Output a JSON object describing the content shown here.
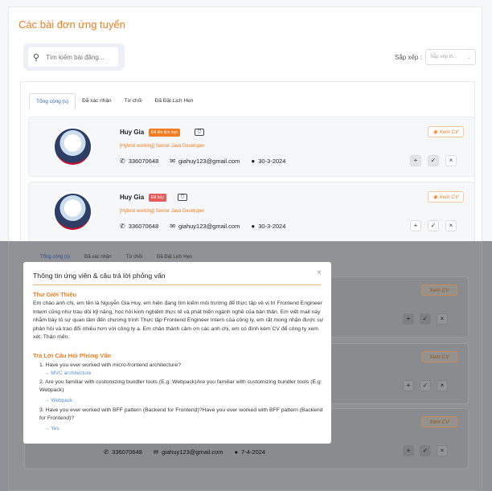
{
  "page": {
    "title": "Các bài đơn ứng tuyển"
  },
  "search": {
    "placeholder": "Tìm kiếm bài đăng..."
  },
  "sort": {
    "label": "Sắp xếp :",
    "placeholder": "Sắp xếp th..."
  },
  "tabs": [
    "Tổng cộng (s)",
    "Đã xác nhận",
    "Từ chối",
    "Đã Đặt Lịch Hẹn"
  ],
  "cards": [
    {
      "name": "Huy Gia",
      "badge": "Đã lên lịch hẹn",
      "job": "[Hybrid working] Senior Java Developer",
      "phone": "336070648",
      "email": "giahuy123@gmail.com",
      "date": "30-3-2024",
      "view": "Xem CV"
    },
    {
      "name": "Huy Gia",
      "badge": "Đã hủy",
      "job": "[Hybrid working] Senior Java Developer",
      "phone": "336070648",
      "email": "giahuy123@gmail.com",
      "date": "30-3-2024",
      "view": "Xem CV"
    }
  ],
  "background": {
    "tabs": [
      "Tổng cộng (s)",
      "Đã xác nhận",
      "Từ chối",
      "Đã Đặt Lịch Hẹn"
    ],
    "view": "Xem CV",
    "last_card": {
      "phone": "336070648",
      "email": "giahuy123@gmail.com",
      "date": "7-4-2024"
    }
  },
  "modal": {
    "title": "Thông tin ứng viên & câu trả lời phỏng vấn",
    "intro_heading": "Thư Giới Thiệu",
    "intro_text": "Em chào anh chị, em tên là Nguyễn Gia Huy, em hiện đang tìm kiếm môi trường để thực tập về vị trí Frontend Engineer Intern cũng như trau dồi kỹ năng, học hỏi kinh nghiệm thực tế và phát triển ngành nghề của bản thân. Em viết mail này nhằm bày tỏ sự quan tâm đến chương trình Thực tập Frontend Engineer Intern của công ty, em rất mong nhận được sự phản hồi và trao đổi nhiều hơn với công ty ạ. Em chân thành cảm ơn các anh chị, em có đính kèm CV để công ty xem xét. Thân mến.",
    "qa_heading": "Trả Lời Câu Hỏi Phỏng Vấn",
    "questions": [
      {
        "q": "1. Have you ever worked with micro-frontend architecture?",
        "a": "→ MVC architecture"
      },
      {
        "q": "2. Are you familiar with customizing bundler tools (E.g: Webpack)Are you familiar with customizing bundler tools (E.g: Webpack)",
        "a": "→ Webpack"
      },
      {
        "q": "3. Have you ever worked with BFF pattern (Backend for Frontend)?Have you ever worked with BFF pattern (Backend for Frontend)?",
        "a": "→ Yes"
      }
    ],
    "close": "×"
  },
  "colors": {
    "accent": "#f07e20",
    "tab_active": "#2f63c8",
    "cancel_badge": "#e85c5c",
    "overlay": "#8f9196"
  },
  "icons": {
    "search": "search-icon",
    "phone": "phone-icon",
    "mail": "mail-icon",
    "clock": "clock-icon",
    "eye": "eye-icon"
  }
}
